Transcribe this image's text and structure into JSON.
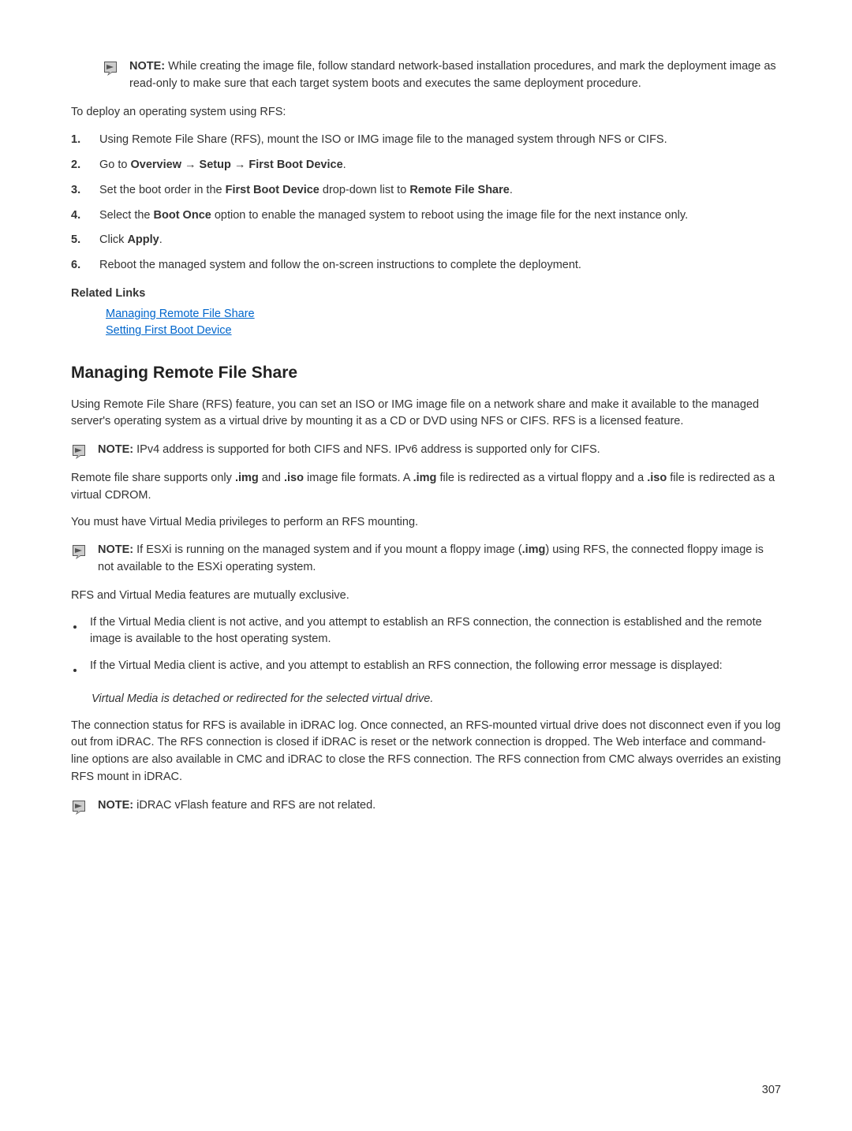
{
  "note1": {
    "label": "NOTE: ",
    "text": "While creating the image file, follow standard network-based installation procedures, and mark the deployment image as read-only to make sure that each target system boots and executes the same deployment procedure."
  },
  "leadIn1": "To deploy an operating system using RFS:",
  "steps": [
    {
      "num": "1.",
      "text": "Using Remote File Share (RFS), mount the ISO or IMG image file to the managed system through NFS or CIFS."
    },
    {
      "num": "2.",
      "prefix": "Go to ",
      "bold": "Overview → Setup → First Boot Device",
      "suffix": "."
    },
    {
      "num": "3.",
      "prefix": "Set the boot order in the ",
      "bold1": "First Boot Device",
      "mid": " drop-down list to ",
      "bold2": "Remote File Share",
      "suffix": "."
    },
    {
      "num": "4.",
      "prefix": "Select the ",
      "bold": "Boot Once",
      "suffix": " option to enable the managed system to reboot using the image file for the next instance only."
    },
    {
      "num": "5.",
      "prefix": "Click ",
      "bold": "Apply",
      "suffix": "."
    },
    {
      "num": "6.",
      "text": "Reboot the managed system and follow the on-screen instructions to complete the deployment."
    }
  ],
  "relatedLinksHeading": "Related Links",
  "relatedLinks": [
    "Managing Remote File Share",
    "Setting First Boot Device"
  ],
  "sectionHeading": "Managing Remote File Share",
  "para1": "Using Remote File Share (RFS) feature, you can set an ISO or IMG image file on a network share and make it available to the managed server's operating system as a virtual drive by mounting it as a CD or DVD using NFS or CIFS. RFS is a licensed feature.",
  "note2": {
    "label": "NOTE: ",
    "text": "IPv4 address is supported for both CIFS and NFS. IPv6 address is supported only for CIFS."
  },
  "para2": {
    "p1": "Remote file share supports only ",
    "b1": ".img",
    "p2": " and ",
    "b2": ".iso",
    "p3": " image file formats. A ",
    "b3": ".img",
    "p4": " file is redirected as a virtual floppy and a ",
    "b4": ".iso",
    "p5": " file is redirected as a virtual CDROM."
  },
  "para3": "You must have Virtual Media privileges to perform an RFS mounting.",
  "note3": {
    "label": "NOTE: ",
    "p1": "If ESXi is running on the managed system and if you mount a floppy image (",
    "b1": ".img",
    "p2": ") using RFS, the connected floppy image is not available to the ESXi operating system."
  },
  "para4": "RFS and Virtual Media features are mutually exclusive.",
  "bullets": [
    "If the Virtual Media client is not active, and you attempt to establish an RFS connection, the connection is established and the remote image is available to the host operating system.",
    "If the Virtual Media client is active, and you attempt to establish an RFS connection, the following error message is displayed:"
  ],
  "italicMsg": "Virtual Media is detached or redirected for the selected virtual drive.",
  "para5": "The connection status for RFS is available in iDRAC log. Once connected, an RFS-mounted virtual drive does not disconnect even if you log out from iDRAC. The RFS connection is closed if iDRAC is reset or the network connection is dropped. The Web interface and command-line options are also available in CMC and iDRAC to close the RFS connection. The RFS connection from CMC always overrides an existing RFS mount in iDRAC.",
  "note4": {
    "label": "NOTE: ",
    "text": "iDRAC vFlash feature and RFS are not related."
  },
  "pageNumber": "307"
}
